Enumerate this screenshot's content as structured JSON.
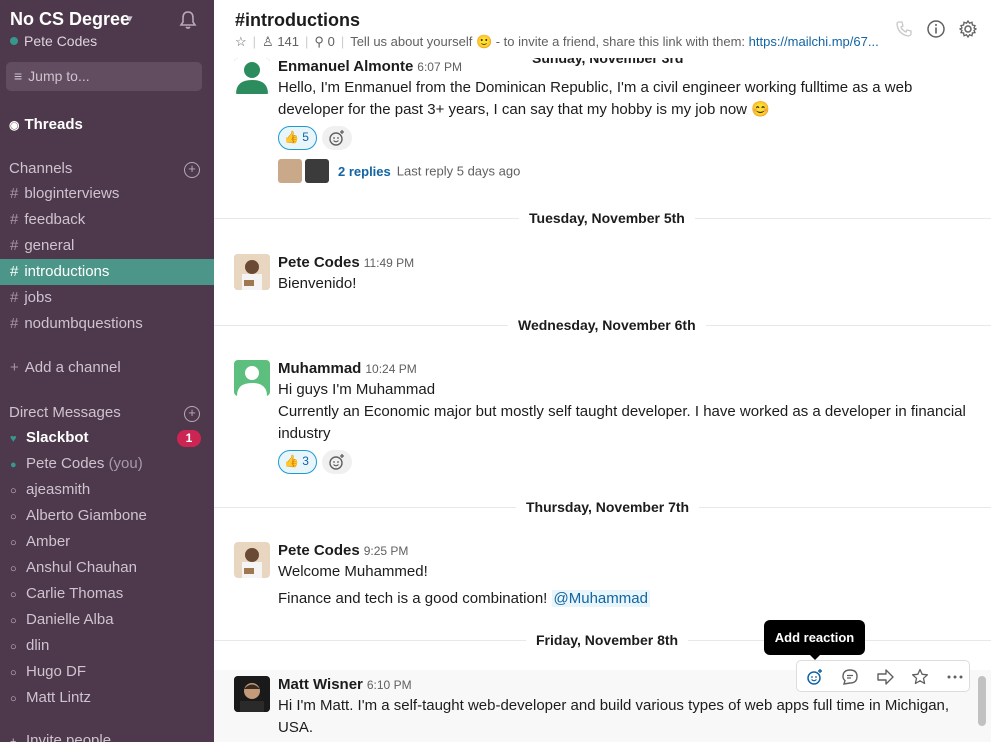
{
  "workspace": {
    "name": "No CS Degree",
    "user": "Pete Codes"
  },
  "sidebar": {
    "jump_placeholder": "Jump to...",
    "threads_label": "Threads",
    "channels_title": "Channels",
    "channels": [
      "bloginterviews",
      "feedback",
      "general",
      "introductions",
      "jobs",
      "nodumbquestions"
    ],
    "active_channel": "introductions",
    "add_channel_label": "Add a channel",
    "dm_title": "Direct Messages",
    "dms": [
      {
        "name": "Slackbot",
        "suffix": "",
        "badge": "1"
      },
      {
        "name": "Pete Codes",
        "suffix": "(you)"
      },
      {
        "name": "ajeasmith"
      },
      {
        "name": "Alberto Giambone"
      },
      {
        "name": "Amber"
      },
      {
        "name": "Anshul Chauhan"
      },
      {
        "name": "Carlie Thomas"
      },
      {
        "name": "Danielle Alba"
      },
      {
        "name": "dlin"
      },
      {
        "name": "Hugo DF"
      },
      {
        "name": "Matt Lintz"
      }
    ],
    "invite_label": "Invite people"
  },
  "header": {
    "title": "#introductions",
    "members": "141",
    "pins": "0",
    "topic": "Tell us about yourself 🙂 - to invite a friend, share this link with them:",
    "topic_link": "https://mailchi.mp/67..."
  },
  "messages": {
    "m1": {
      "author": "Enmanuel Almonte",
      "time": "6:07 PM",
      "text": "Hello, I'm Enmanuel from the Dominican Republic, I'm a civil engineer working fulltime as a web developer for the past 3+ years, I can say that my hobby is my job now 😊",
      "reaction_emoji": "👍",
      "reaction_count": "5",
      "replies": "2 replies",
      "last_reply": "Last reply 5 days ago"
    },
    "day1": "Sunday, November 3rd",
    "day2": "Tuesday, November 5th",
    "m2": {
      "author": "Pete Codes",
      "time": "11:49 PM",
      "text": "Bienvenido!"
    },
    "day3": "Wednesday, November 6th",
    "m3": {
      "author": "Muhammad",
      "time": "10:24 PM",
      "line1": "Hi guys I'm Muhammad",
      "line2": "Currently an Economic major but mostly self taught developer. I have worked as a developer in financial industry",
      "reaction_emoji": "👍",
      "reaction_count": "3"
    },
    "day4": "Thursday, November 7th",
    "m4": {
      "author": "Pete Codes",
      "time": "9:25 PM",
      "line1": "Welcome Muhammed!",
      "line2": "Finance and tech is a good combination!",
      "mention": "@Muhammad"
    },
    "day5": "Friday, November 8th",
    "m5": {
      "author": "Matt Wisner",
      "time": "6:10 PM",
      "text": "Hi I'm Matt. I'm a self-taught web-developer and build various types of web apps full time in Michigan, USA."
    }
  },
  "tooltip": "Add reaction",
  "colors": {
    "sidebar": "#4d394b",
    "active": "#4c9689",
    "link": "#1264a3",
    "badge": "#cd2553"
  }
}
